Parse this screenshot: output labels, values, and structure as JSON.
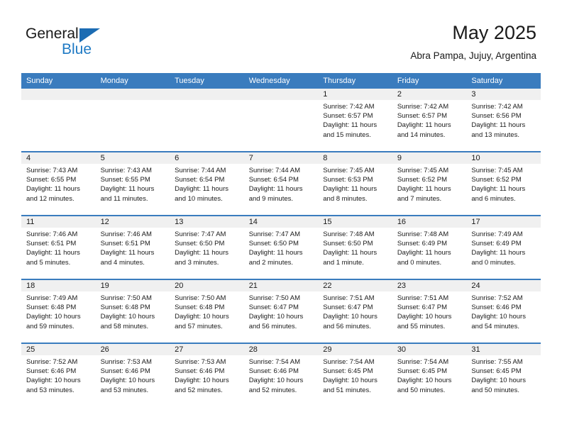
{
  "brand": {
    "name_part1": "General",
    "name_part2": "Blue",
    "triangle_icon": "triangle-icon",
    "accent_color": "#1f7ac4"
  },
  "header": {
    "title": "May 2025",
    "subtitle": "Abra Pampa, Jujuy, Argentina"
  },
  "calendar": {
    "header_bg": "#3a7cbe",
    "daynum_bg": "#f0f0f0",
    "weekdays": [
      "Sunday",
      "Monday",
      "Tuesday",
      "Wednesday",
      "Thursday",
      "Friday",
      "Saturday"
    ],
    "weeks": [
      [
        {
          "day": "",
          "sunrise": "",
          "sunset": "",
          "daylight": "",
          "empty": true
        },
        {
          "day": "",
          "sunrise": "",
          "sunset": "",
          "daylight": "",
          "empty": true
        },
        {
          "day": "",
          "sunrise": "",
          "sunset": "",
          "daylight": "",
          "empty": true
        },
        {
          "day": "",
          "sunrise": "",
          "sunset": "",
          "daylight": "",
          "empty": true
        },
        {
          "day": "1",
          "sunrise": "Sunrise: 7:42 AM",
          "sunset": "Sunset: 6:57 PM",
          "daylight": "Daylight: 11 hours and 15 minutes."
        },
        {
          "day": "2",
          "sunrise": "Sunrise: 7:42 AM",
          "sunset": "Sunset: 6:57 PM",
          "daylight": "Daylight: 11 hours and 14 minutes."
        },
        {
          "day": "3",
          "sunrise": "Sunrise: 7:42 AM",
          "sunset": "Sunset: 6:56 PM",
          "daylight": "Daylight: 11 hours and 13 minutes."
        }
      ],
      [
        {
          "day": "4",
          "sunrise": "Sunrise: 7:43 AM",
          "sunset": "Sunset: 6:55 PM",
          "daylight": "Daylight: 11 hours and 12 minutes."
        },
        {
          "day": "5",
          "sunrise": "Sunrise: 7:43 AM",
          "sunset": "Sunset: 6:55 PM",
          "daylight": "Daylight: 11 hours and 11 minutes."
        },
        {
          "day": "6",
          "sunrise": "Sunrise: 7:44 AM",
          "sunset": "Sunset: 6:54 PM",
          "daylight": "Daylight: 11 hours and 10 minutes."
        },
        {
          "day": "7",
          "sunrise": "Sunrise: 7:44 AM",
          "sunset": "Sunset: 6:54 PM",
          "daylight": "Daylight: 11 hours and 9 minutes."
        },
        {
          "day": "8",
          "sunrise": "Sunrise: 7:45 AM",
          "sunset": "Sunset: 6:53 PM",
          "daylight": "Daylight: 11 hours and 8 minutes."
        },
        {
          "day": "9",
          "sunrise": "Sunrise: 7:45 AM",
          "sunset": "Sunset: 6:52 PM",
          "daylight": "Daylight: 11 hours and 7 minutes."
        },
        {
          "day": "10",
          "sunrise": "Sunrise: 7:45 AM",
          "sunset": "Sunset: 6:52 PM",
          "daylight": "Daylight: 11 hours and 6 minutes."
        }
      ],
      [
        {
          "day": "11",
          "sunrise": "Sunrise: 7:46 AM",
          "sunset": "Sunset: 6:51 PM",
          "daylight": "Daylight: 11 hours and 5 minutes."
        },
        {
          "day": "12",
          "sunrise": "Sunrise: 7:46 AM",
          "sunset": "Sunset: 6:51 PM",
          "daylight": "Daylight: 11 hours and 4 minutes."
        },
        {
          "day": "13",
          "sunrise": "Sunrise: 7:47 AM",
          "sunset": "Sunset: 6:50 PM",
          "daylight": "Daylight: 11 hours and 3 minutes."
        },
        {
          "day": "14",
          "sunrise": "Sunrise: 7:47 AM",
          "sunset": "Sunset: 6:50 PM",
          "daylight": "Daylight: 11 hours and 2 minutes."
        },
        {
          "day": "15",
          "sunrise": "Sunrise: 7:48 AM",
          "sunset": "Sunset: 6:50 PM",
          "daylight": "Daylight: 11 hours and 1 minute."
        },
        {
          "day": "16",
          "sunrise": "Sunrise: 7:48 AM",
          "sunset": "Sunset: 6:49 PM",
          "daylight": "Daylight: 11 hours and 0 minutes."
        },
        {
          "day": "17",
          "sunrise": "Sunrise: 7:49 AM",
          "sunset": "Sunset: 6:49 PM",
          "daylight": "Daylight: 11 hours and 0 minutes."
        }
      ],
      [
        {
          "day": "18",
          "sunrise": "Sunrise: 7:49 AM",
          "sunset": "Sunset: 6:48 PM",
          "daylight": "Daylight: 10 hours and 59 minutes."
        },
        {
          "day": "19",
          "sunrise": "Sunrise: 7:50 AM",
          "sunset": "Sunset: 6:48 PM",
          "daylight": "Daylight: 10 hours and 58 minutes."
        },
        {
          "day": "20",
          "sunrise": "Sunrise: 7:50 AM",
          "sunset": "Sunset: 6:48 PM",
          "daylight": "Daylight: 10 hours and 57 minutes."
        },
        {
          "day": "21",
          "sunrise": "Sunrise: 7:50 AM",
          "sunset": "Sunset: 6:47 PM",
          "daylight": "Daylight: 10 hours and 56 minutes."
        },
        {
          "day": "22",
          "sunrise": "Sunrise: 7:51 AM",
          "sunset": "Sunset: 6:47 PM",
          "daylight": "Daylight: 10 hours and 56 minutes."
        },
        {
          "day": "23",
          "sunrise": "Sunrise: 7:51 AM",
          "sunset": "Sunset: 6:47 PM",
          "daylight": "Daylight: 10 hours and 55 minutes."
        },
        {
          "day": "24",
          "sunrise": "Sunrise: 7:52 AM",
          "sunset": "Sunset: 6:46 PM",
          "daylight": "Daylight: 10 hours and 54 minutes."
        }
      ],
      [
        {
          "day": "25",
          "sunrise": "Sunrise: 7:52 AM",
          "sunset": "Sunset: 6:46 PM",
          "daylight": "Daylight: 10 hours and 53 minutes."
        },
        {
          "day": "26",
          "sunrise": "Sunrise: 7:53 AM",
          "sunset": "Sunset: 6:46 PM",
          "daylight": "Daylight: 10 hours and 53 minutes."
        },
        {
          "day": "27",
          "sunrise": "Sunrise: 7:53 AM",
          "sunset": "Sunset: 6:46 PM",
          "daylight": "Daylight: 10 hours and 52 minutes."
        },
        {
          "day": "28",
          "sunrise": "Sunrise: 7:54 AM",
          "sunset": "Sunset: 6:46 PM",
          "daylight": "Daylight: 10 hours and 52 minutes."
        },
        {
          "day": "29",
          "sunrise": "Sunrise: 7:54 AM",
          "sunset": "Sunset: 6:45 PM",
          "daylight": "Daylight: 10 hours and 51 minutes."
        },
        {
          "day": "30",
          "sunrise": "Sunrise: 7:54 AM",
          "sunset": "Sunset: 6:45 PM",
          "daylight": "Daylight: 10 hours and 50 minutes."
        },
        {
          "day": "31",
          "sunrise": "Sunrise: 7:55 AM",
          "sunset": "Sunset: 6:45 PM",
          "daylight": "Daylight: 10 hours and 50 minutes."
        }
      ]
    ]
  }
}
